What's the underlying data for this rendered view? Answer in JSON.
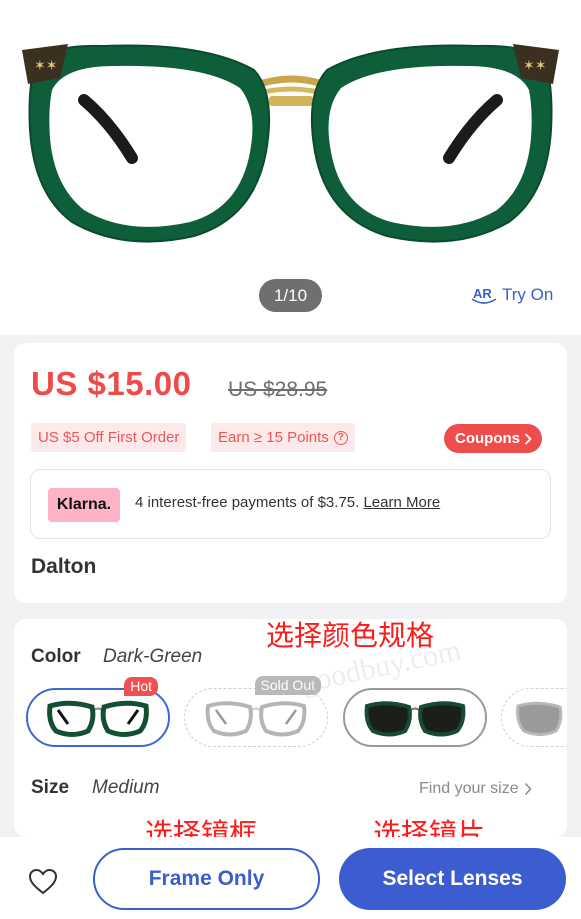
{
  "gallery": {
    "pager": "1/10",
    "try_on": "Try On",
    "try_on_icon": "ar-icon",
    "frame_color": "#1f6b45"
  },
  "pricing": {
    "price": "US $15.00",
    "old_price": "US $28.95",
    "tags": [
      "US $5 Off First Order",
      "Earn ≥ 15 Points"
    ],
    "coupons": "Coupons",
    "accent": "#ee4b4b"
  },
  "klarna": {
    "logo": "Klarna.",
    "text": "4 interest-free payments of $3.75.",
    "link": "Learn More"
  },
  "product": {
    "name": "Dalton"
  },
  "options": {
    "color_label": "Color",
    "color_value": "Dark-Green",
    "swatches": [
      {
        "name": "dark-green",
        "badge": "Hot",
        "selected": true,
        "lens": "clear"
      },
      {
        "name": "grey",
        "badge": "Sold Out",
        "selected": false,
        "lens": "clear"
      },
      {
        "name": "dark-sun",
        "badge": "",
        "selected": false,
        "lens": "tinted"
      },
      {
        "name": "grey-sun",
        "badge": "",
        "selected": false,
        "lens": "grey"
      }
    ],
    "size_label": "Size",
    "size_value": "Medium",
    "find_size": "Find your size"
  },
  "watermark": "goodbuy.com",
  "annotations": {
    "color_spec": "选择颜色规格",
    "frame": "选择镜框",
    "lens": "选择镜片"
  },
  "actions": {
    "favorite_icon": "heart-icon",
    "frame_only": "Frame Only",
    "select_lenses": "Select Lenses",
    "brand_blue": "#3c5dd0"
  }
}
